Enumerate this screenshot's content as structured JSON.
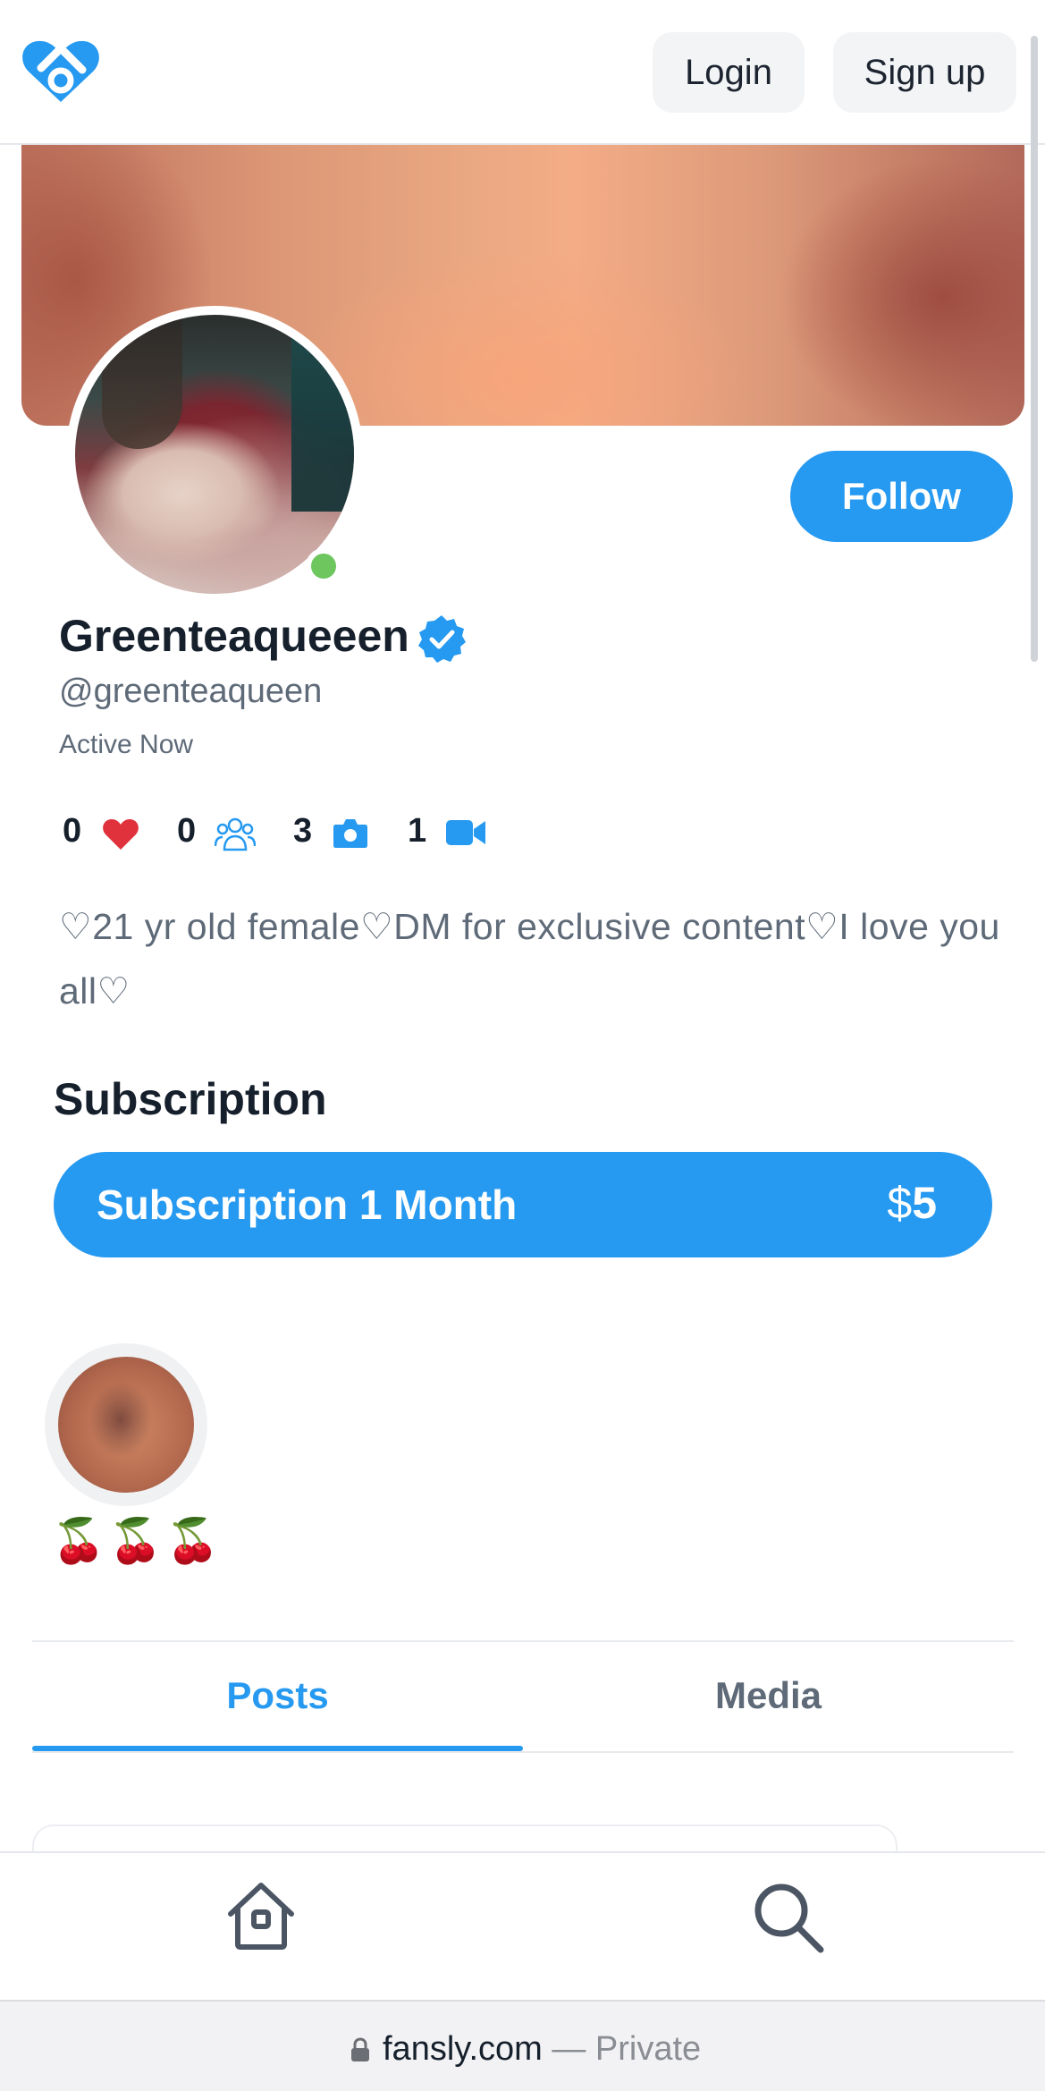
{
  "header": {
    "logo_icon": "fansly-heart-logo",
    "login_label": "Login",
    "signup_label": "Sign up"
  },
  "profile": {
    "display_name": "Greenteaqueeen",
    "verified_icon": "verified-badge-icon",
    "handle": "@greenteaqueen",
    "status": "Active Now",
    "online": true,
    "follow_label": "Follow",
    "stats": {
      "likes": "0",
      "fans": "0",
      "photos": "3",
      "videos": "1"
    },
    "bio": "♡21 yr old female♡DM for exclusive content♡I love you all♡"
  },
  "subscription": {
    "heading": "Subscription",
    "tier_label": "Subscription 1 Month",
    "currency_symbol": "$",
    "price": "5"
  },
  "story": {
    "label": "🍒🍒🍒"
  },
  "tabs": [
    {
      "label": "Posts",
      "active": true
    },
    {
      "label": "Media",
      "active": false
    }
  ],
  "bottom_nav": {
    "home_icon": "home-icon",
    "search_icon": "search-icon"
  },
  "browser": {
    "domain": "fansly.com",
    "mode_suffix": " — Private"
  },
  "colors": {
    "accent": "#2699f0",
    "online": "#6dc65e",
    "like_red": "#e0323c",
    "text_primary": "#16202c",
    "text_secondary": "#5e6a78"
  }
}
